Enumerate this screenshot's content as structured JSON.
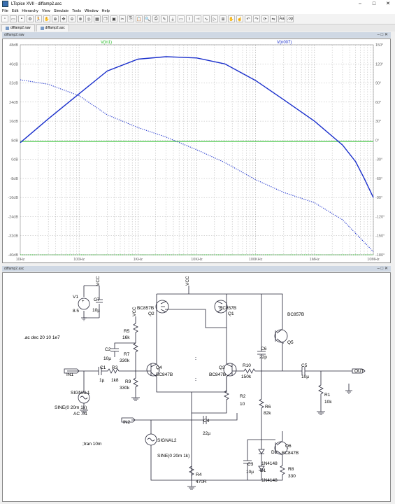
{
  "window": {
    "title": "LTspice XVII - diffamp2.asc",
    "min": "–",
    "max": "□",
    "close": "✕"
  },
  "menu": [
    "File",
    "Edit",
    "Hierarchy",
    "View",
    "Simulate",
    "Tools",
    "Window",
    "Help"
  ],
  "tabs": [
    {
      "label": "diffamp2.raw"
    },
    {
      "label": "diffamp2.asc"
    }
  ],
  "plot_pane": {
    "title": "diffamp2.raw",
    "ctl": "– □ ✕"
  },
  "schematic_pane": {
    "title": "diffamp2.asc",
    "ctl": "– □ ✕"
  },
  "chart_data": {
    "type": "line",
    "x_scale": "log",
    "xlim": [
      10,
      10000000
    ],
    "x_ticks": [
      "10Hz",
      "100Hz",
      "1KHz",
      "10KHz",
      "100KHz",
      "1MHz",
      "10MHz"
    ],
    "y_left_ticks": [
      "48dB",
      "40dB",
      "32dB",
      "24dB",
      "16dB",
      "8dB",
      "0dB",
      "-8dB",
      "-16dB",
      "-24dB",
      "-32dB",
      "-40dB"
    ],
    "y_left_lim": [
      -40,
      48
    ],
    "y_right_ticks": [
      "150°",
      "120°",
      "90°",
      "60°",
      "30°",
      "0°",
      "-30°",
      "-60°",
      "-90°",
      "-120°",
      "-150°",
      "-180°"
    ],
    "y_right_lim": [
      -180,
      150
    ],
    "grid": true,
    "series": [
      {
        "name": "V(in1)",
        "color": "#22bb22",
        "mag_db": [
          [
            10,
            7.5
          ],
          [
            10000000,
            7.5
          ]
        ],
        "phase_deg": [
          [
            10,
            -180
          ],
          [
            10000000,
            -180
          ]
        ]
      },
      {
        "name": "V(n007)",
        "color": "#1a2fcc",
        "mag_db": [
          [
            10,
            7
          ],
          [
            30,
            17
          ],
          [
            100,
            27.5
          ],
          [
            300,
            37
          ],
          [
            1000,
            42
          ],
          [
            3000,
            43
          ],
          [
            10000,
            42.5
          ],
          [
            30000,
            40
          ],
          [
            100000,
            33
          ],
          [
            300000,
            25
          ],
          [
            1000000,
            16
          ],
          [
            3000000,
            6
          ],
          [
            5000000,
            -1
          ],
          [
            7000000,
            -8
          ],
          [
            10000000,
            -16
          ]
        ],
        "phase_deg": [
          [
            10,
            95
          ],
          [
            30,
            88
          ],
          [
            100,
            70
          ],
          [
            300,
            40
          ],
          [
            1000,
            20
          ],
          [
            3000,
            5
          ],
          [
            10000,
            -15
          ],
          [
            30000,
            -35
          ],
          [
            100000,
            -62
          ],
          [
            300000,
            -82
          ],
          [
            1000000,
            -98
          ],
          [
            3000000,
            -125
          ],
          [
            10000000,
            -175
          ]
        ]
      }
    ]
  },
  "schematic": {
    "labels": {
      "vcc1": "VCC",
      "v1": "V1",
      "v1val": "8.5",
      "c7": "C7",
      "c7val": "10µ",
      "vcc2": "VCC",
      "q2name": "BC857B",
      "q2": "Q2",
      "q1name": "BC857B",
      "q1": "Q1",
      "vcc3": "VCC",
      "r5": "R5",
      "r5val": "16k",
      "c2": "C2",
      "c2val": "10µ",
      "r7": "R7",
      "r7val": "330k",
      "ac": ".ac dec 20 10 1e7",
      "q4": "Q4",
      "q4name": "BC847B",
      "q3": "Q3",
      "q3name": "BC847B",
      "c6": "C6",
      "c6val": "22p",
      "r10": "R10",
      "r10val": "150k",
      "c5": "C5",
      "c5val": "10µ",
      "q5name": "BC857B",
      "q5": "Q5",
      "in1": "IN1",
      "c1": "C1",
      "c1val": "1µ",
      "r3": "R3",
      "r3val": "1k8",
      "r9": "R9",
      "r9val": "330k",
      "out": "OUT",
      "signal1": "SIGNAL1",
      "sine1": "SINE(0 20m 1k)",
      "ac1": "AC .01",
      "r2": "R2",
      "r2val": "10",
      "r1": "R1",
      "r1val": "10k",
      "r6": "R6",
      "r6val": "82k",
      "in2": "IN2",
      "c4": "C4",
      "c4val": "22µ",
      "tran": ";tran 10m",
      "signal2": "SIGNAL2",
      "sine2": "SINE(0 20m 1k)",
      "q6": "Q6",
      "q6name": "BC847B",
      "d2": "D2",
      "d2name": "1N4148",
      "d1": "D1",
      "d1name": "1N4148",
      "c3": "C3",
      "c3val": "10µ",
      "r8": "R8",
      "r8val": "330",
      "r4": "R4",
      "r4val": "470R"
    }
  }
}
